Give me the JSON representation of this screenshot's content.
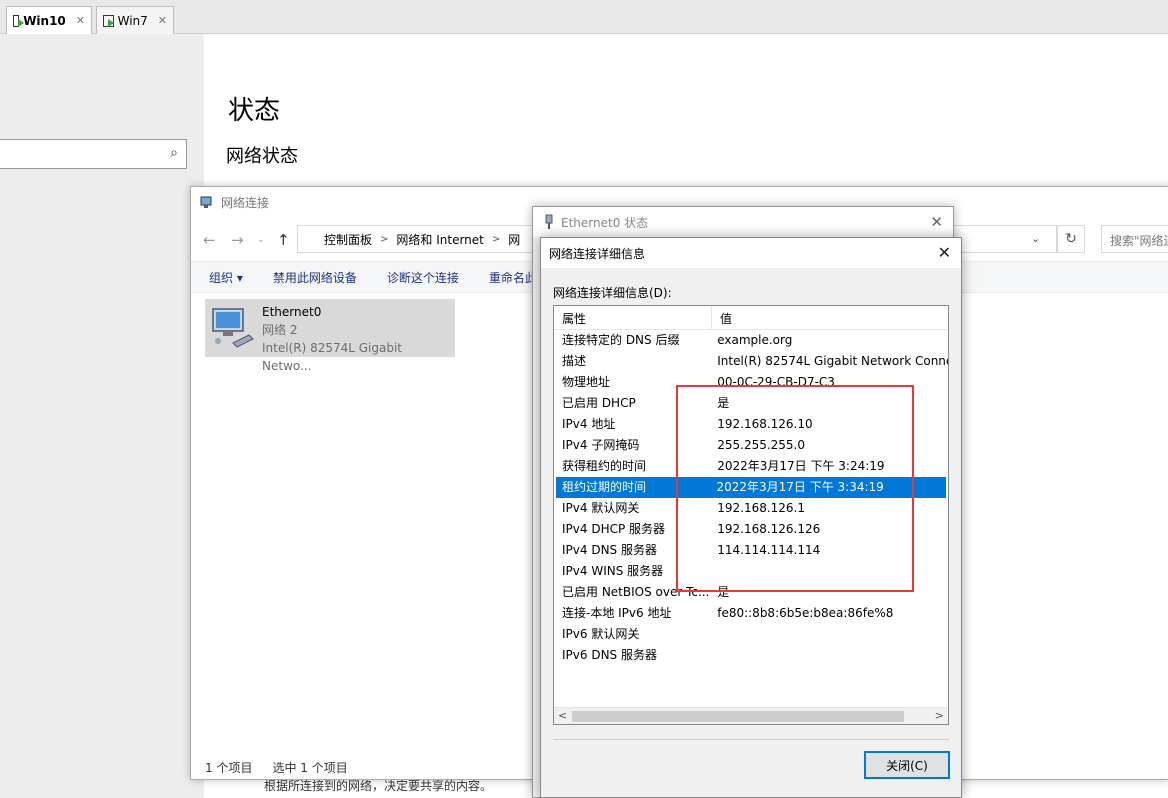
{
  "vm_tabs": [
    {
      "label": "Win10",
      "close": "✕"
    },
    {
      "label": "Win7",
      "close": "✕"
    }
  ],
  "settings": {
    "title": "状态",
    "subtitle": "网络状态",
    "bottom_text": "根据所连接到的网络，决定要共享的内容。"
  },
  "network_window": {
    "title": "网络连接",
    "breadcrumb": [
      "控制面板",
      "网络和 Internet",
      "网"
    ],
    "search_placeholder": "搜索\"网络连",
    "toolbar": [
      "组织 ▾",
      "禁用此网络设备",
      "诊断这个连接",
      "重命名此"
    ],
    "item": {
      "name": "Ethernet0",
      "network": "网络 2",
      "adapter": "Intel(R) 82574L Gigabit Netwo..."
    },
    "status": {
      "count": "1 个项目",
      "selected": "选中 1 个项目"
    }
  },
  "ethernet_dialog": {
    "title": "Ethernet0 状态"
  },
  "details_dialog": {
    "title": "网络连接详细信息",
    "label": "网络连接详细信息(D):",
    "col_property": "属性",
    "col_value": "值",
    "rows": [
      {
        "prop": "连接特定的 DNS 后缀",
        "val": "example.org"
      },
      {
        "prop": "描述",
        "val": "Intel(R) 82574L Gigabit Network Connec"
      },
      {
        "prop": "物理地址",
        "val": "00-0C-29-CB-D7-C3"
      },
      {
        "prop": "已启用 DHCP",
        "val": "是"
      },
      {
        "prop": "IPv4 地址",
        "val": "192.168.126.10"
      },
      {
        "prop": "IPv4 子网掩码",
        "val": "255.255.255.0"
      },
      {
        "prop": "获得租约的时间",
        "val": "2022年3月17日 下午 3:24:19"
      },
      {
        "prop": "租约过期的时间",
        "val": "2022年3月17日 下午 3:34:19"
      },
      {
        "prop": "IPv4 默认网关",
        "val": "192.168.126.1"
      },
      {
        "prop": "IPv4 DHCP 服务器",
        "val": "192.168.126.126"
      },
      {
        "prop": "IPv4 DNS 服务器",
        "val": "114.114.114.114"
      },
      {
        "prop": "IPv4 WINS 服务器",
        "val": ""
      },
      {
        "prop": "已启用 NetBIOS over Tc...",
        "val": "是"
      },
      {
        "prop": "连接-本地 IPv6 地址",
        "val": "fe80::8b8:6b5e:b8ea:86fe%8"
      },
      {
        "prop": "IPv6 默认网关",
        "val": ""
      },
      {
        "prop": "IPv6 DNS 服务器",
        "val": ""
      }
    ],
    "selected_row": 7,
    "close_button": "关闭(C)"
  },
  "colors": {
    "selection": "#0078d7",
    "annotation": "#e53935"
  }
}
